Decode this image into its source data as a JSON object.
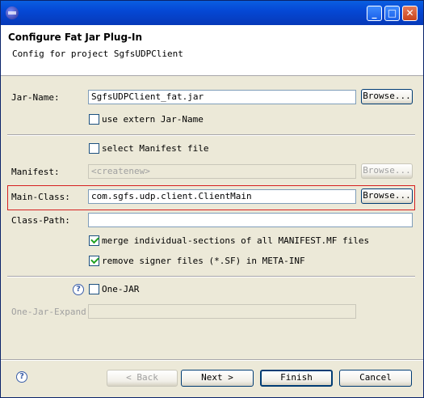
{
  "window": {
    "app_icon": "eclipse-icon",
    "controls": {
      "minimize": "_",
      "maximize": "□",
      "close": "✕"
    }
  },
  "header": {
    "title": "Configure Fat Jar Plug-In",
    "subtitle": "Config for project SgfsUDPClient"
  },
  "form": {
    "jar_name": {
      "label": "Jar-Name:",
      "value": "SgfsUDPClient_fat.jar",
      "browse": "Browse..."
    },
    "use_extern": {
      "label": "use extern Jar-Name",
      "checked": false
    },
    "select_manifest": {
      "label": "select Manifest file",
      "checked": false
    },
    "manifest": {
      "label": "Manifest:",
      "value": "<createnew>",
      "browse": "Browse..."
    },
    "main_class": {
      "label": "Main-Class:",
      "value": "com.sgfs.udp.client.ClientMain",
      "browse": "Browse..."
    },
    "class_path": {
      "label": "Class-Path:",
      "value": ""
    },
    "merge_sections": {
      "label": "merge individual-sections of all MANIFEST.MF files",
      "checked": true
    },
    "remove_signer": {
      "label": "remove signer files (*.SF) in META-INF",
      "checked": true
    },
    "one_jar": {
      "label": "One-JAR",
      "checked": false
    },
    "one_jar_expand": {
      "label": "One-Jar-Expand:",
      "value": ""
    }
  },
  "buttons": {
    "back": "< Back",
    "next": "Next >",
    "finish": "Finish",
    "cancel": "Cancel"
  },
  "icons": {
    "help": "?"
  }
}
